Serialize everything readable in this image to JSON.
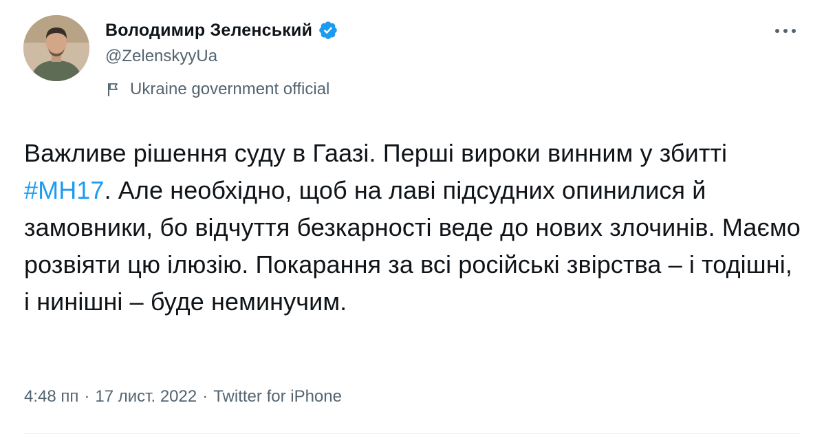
{
  "tweet": {
    "author": {
      "display_name": "Володимир Зеленський",
      "handle": "@ZelenskyyUa",
      "label": "Ukraine government official",
      "avatar_icon": "profile-photo",
      "verified_icon": "verified-badge-icon",
      "label_icon": "flag-icon"
    },
    "more_icon": "more-dots-icon",
    "text": {
      "part1": "Важливе рішення суду в Гаазі. Перші вироки винним у збитті ",
      "hashtag": "#MH17",
      "part2": ". Але необхідно, щоб на лаві підсудних опинилися й замовники, бо відчуття безкарності веде до нових злочинів. Маємо розвіяти цю ілюзію. Покарання за всі російські звірства – і тодішні, і нинішні – буде неминучим."
    },
    "meta": {
      "time": "4:48 пп",
      "separator": "·",
      "date": "17 лист. 2022",
      "source": "Twitter for iPhone"
    }
  },
  "colors": {
    "text": "#0f1419",
    "secondary": "#536471",
    "link": "#1d9bf0",
    "verified": "#1d9bf0"
  }
}
